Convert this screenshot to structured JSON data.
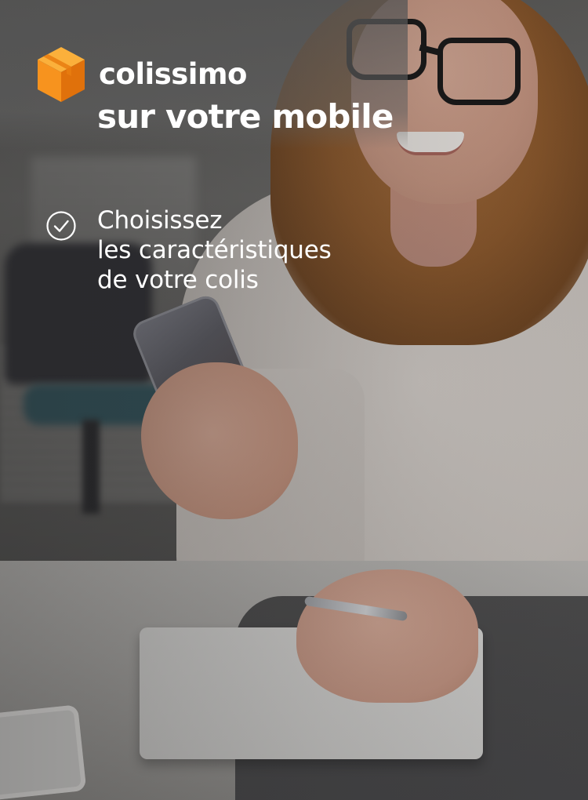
{
  "brand": {
    "name": "colissimo",
    "logo_icon": "package-box-icon",
    "logo_color": "#f28c00"
  },
  "headline": {
    "tagline": "sur votre mobile"
  },
  "feature": {
    "icon": "check-circle-icon",
    "lines": [
      "Choisissez",
      "les caractéristiques",
      "de votre colis"
    ]
  },
  "colors": {
    "text": "#ffffff",
    "accent_orange": "#f28c00"
  }
}
